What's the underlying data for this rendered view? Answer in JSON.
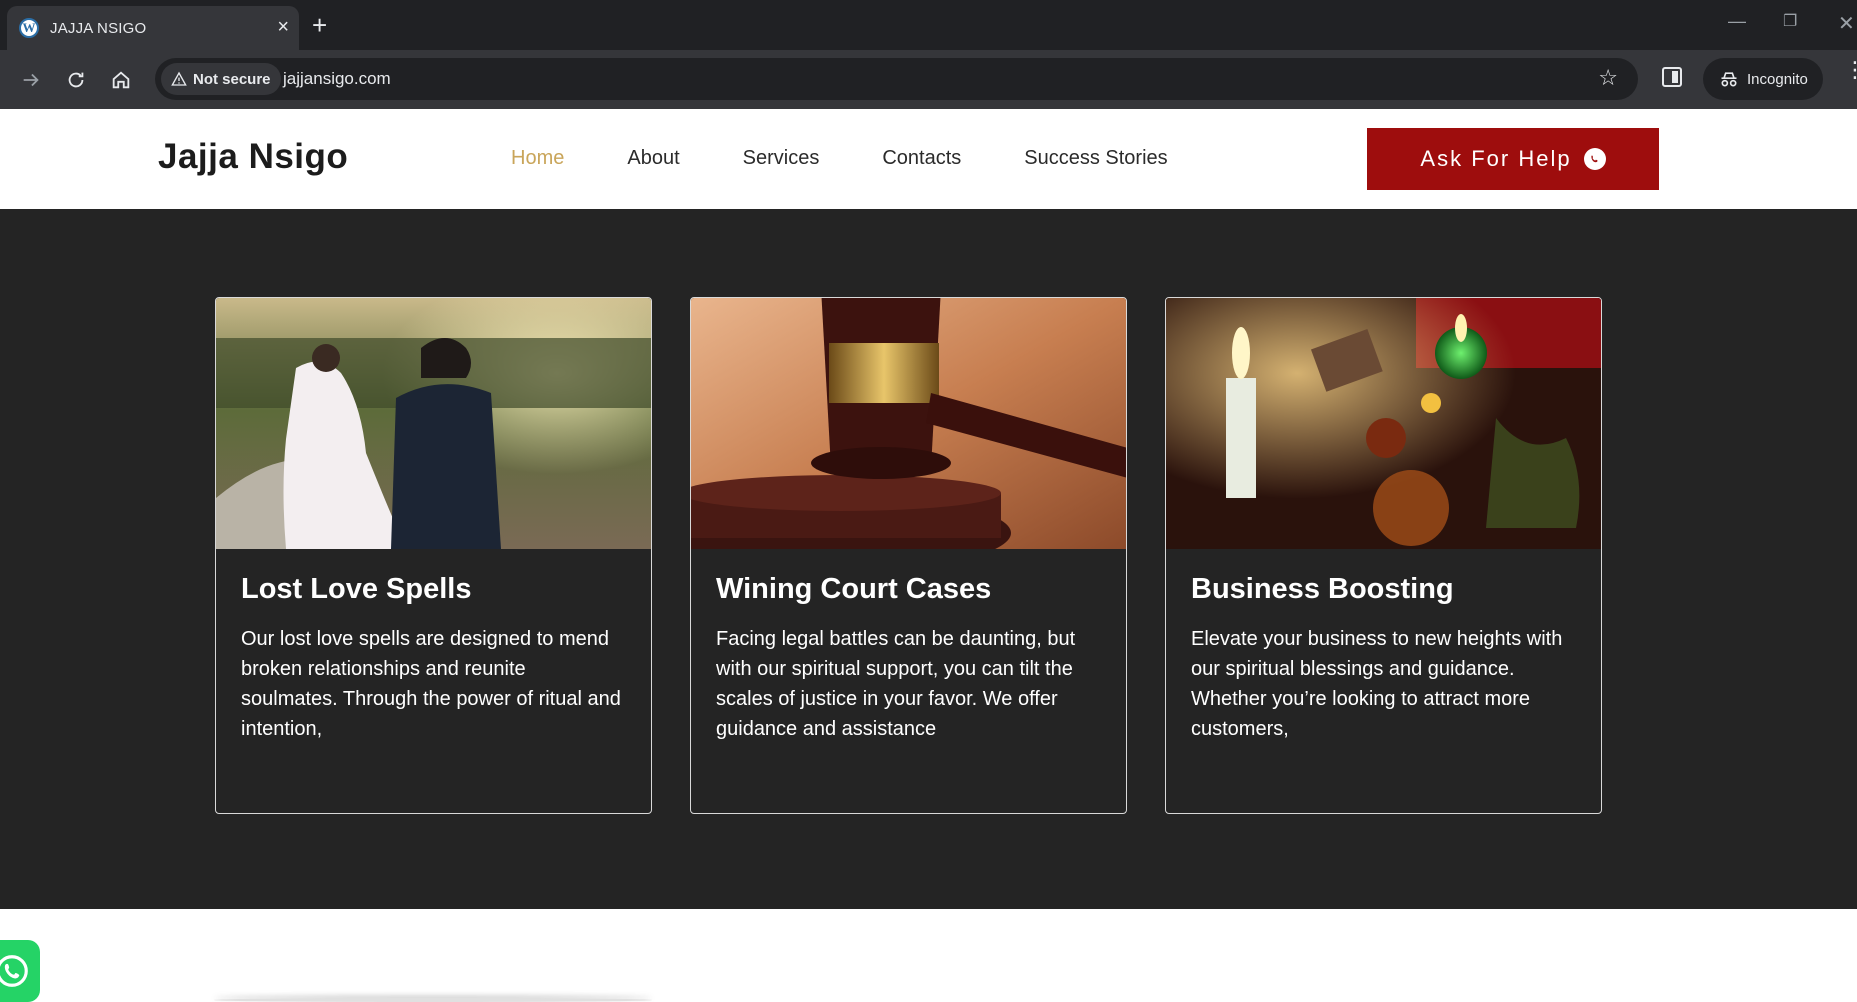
{
  "browser": {
    "tab_title": "JAJJA NSIGO",
    "favicon_letter": "W",
    "security_label": "Not secure",
    "url": "jajjansigo.com",
    "incognito_label": "Incognito"
  },
  "header": {
    "brand": "Jajja Nsigo",
    "nav": [
      "Home",
      "About",
      "Services",
      "Contacts",
      "Success Stories"
    ],
    "active_nav": "Home",
    "cta_label": "Ask For Help"
  },
  "cards": [
    {
      "image": "wedding-couple-photo",
      "title": "Lost Love Spells",
      "text": " Our lost love spells are designed to mend broken relationships and reunite soulmates. Through the power of ritual and intention,"
    },
    {
      "image": "judge-gavel-photo",
      "title": "Wining Court Cases",
      "text": "Facing legal battles can be daunting, but with our spiritual support, you can tilt the scales of justice in your favor. We offer guidance and assistance"
    },
    {
      "image": "candles-ritual-photo",
      "title": "Business Boosting",
      "text": "Elevate your business to new heights with our spiritual blessings and guidance. Whether you’re looking to attract more customers,"
    }
  ],
  "colors": {
    "nav_active": "#c9a55a",
    "cta_bg": "#9e0d0d",
    "section_bg": "#242424",
    "whatsapp": "#25d366"
  }
}
